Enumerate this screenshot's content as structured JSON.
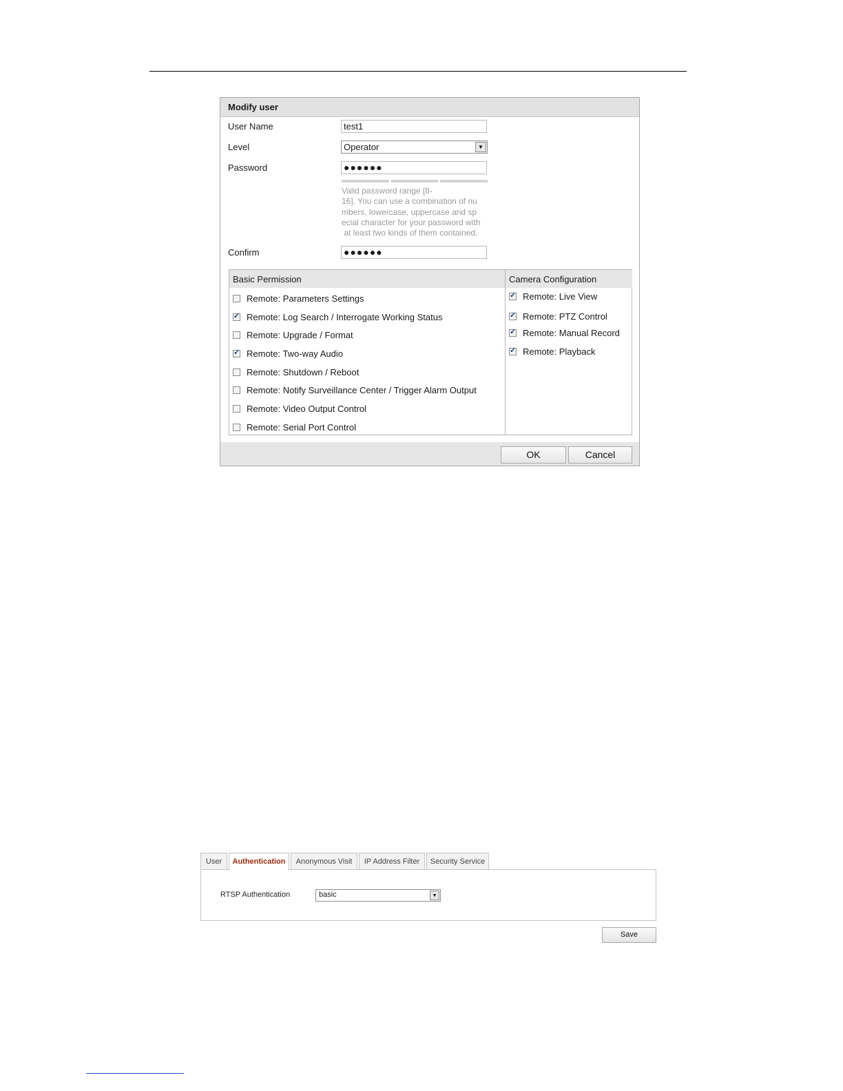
{
  "dialog": {
    "title": "Modify user",
    "fields": {
      "username_label": "User Name",
      "username_value": "test1",
      "level_label": "Level",
      "level_value": "Operator",
      "password_label": "Password",
      "password_value": "●●●●●●",
      "password_hint_lines": [
        "Valid password range [8-",
        "16]. You can use a combination of nu",
        "mbers, lowercase, uppercase and sp",
        "ecial character for your password with",
        " at least two kinds of them contained."
      ],
      "confirm_label": "Confirm",
      "confirm_value": "●●●●●●"
    },
    "basic_permission": {
      "header": "Basic Permission",
      "items": [
        {
          "label": "Remote: Parameters Settings",
          "checked": false
        },
        {
          "label": "Remote: Log Search / Interrogate Working Status",
          "checked": true
        },
        {
          "label": "Remote: Upgrade / Format",
          "checked": false
        },
        {
          "label": "Remote: Two-way Audio",
          "checked": true
        },
        {
          "label": "Remote: Shutdown / Reboot",
          "checked": false
        },
        {
          "label": "Remote: Notify Surveillance Center / Trigger Alarm Output",
          "checked": false
        },
        {
          "label": "Remote: Video Output Control",
          "checked": false
        },
        {
          "label": "Remote: Serial Port Control",
          "checked": false
        }
      ]
    },
    "camera_configuration": {
      "header": "Camera Configuration",
      "items": [
        {
          "label": "Remote: Live View",
          "checked": true
        },
        {
          "label": "Remote: PTZ Control",
          "checked": true
        },
        {
          "label": "Remote: Manual Record",
          "checked": true
        },
        {
          "label": "Remote: Playback",
          "checked": true
        }
      ]
    },
    "ok_label": "OK",
    "cancel_label": "Cancel"
  },
  "auth": {
    "tabs": [
      {
        "label": "User",
        "active": false
      },
      {
        "label": "Authentication",
        "active": true
      },
      {
        "label": "Anonymous Visit",
        "active": false
      },
      {
        "label": "IP Address Filter",
        "active": false
      },
      {
        "label": "Security Service",
        "active": false
      }
    ],
    "rtsp_label": "RTSP Authentication",
    "rtsp_value": "basic",
    "save_label": "Save"
  },
  "colors": {
    "active_tab_text": "#9b2b10",
    "header_bg": "#e2e2e2",
    "check_mark": "#1b3d7a"
  }
}
